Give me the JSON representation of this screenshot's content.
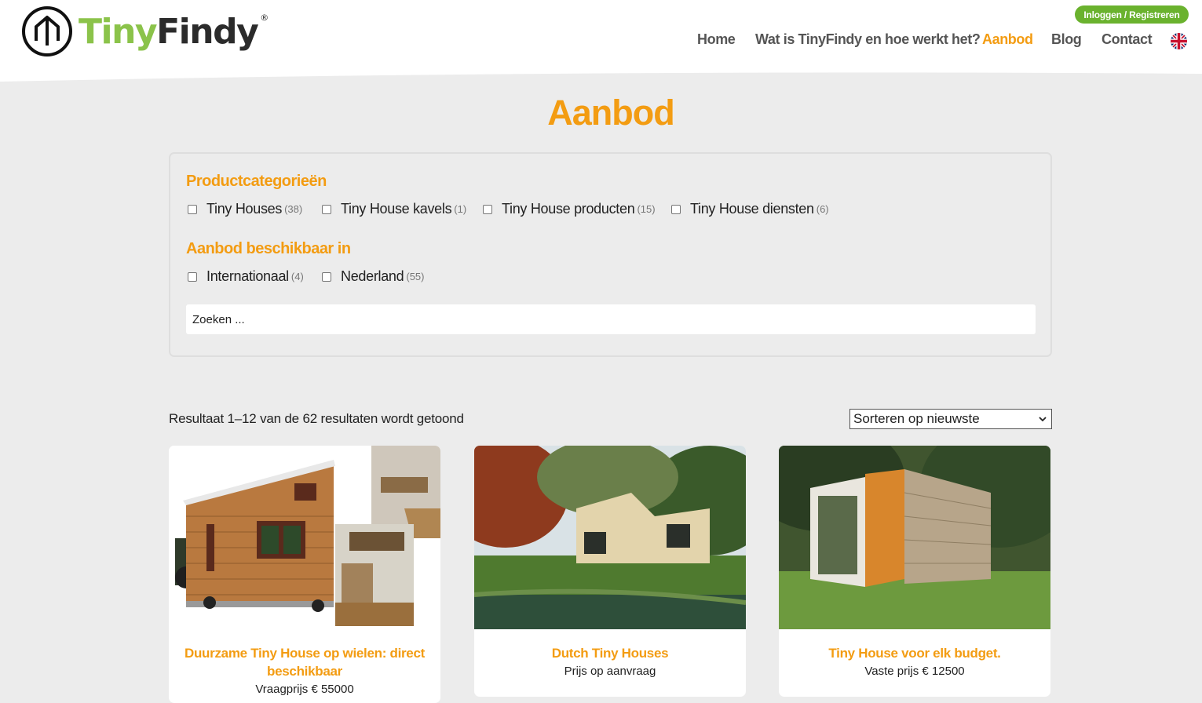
{
  "brand": {
    "name_part1": "Tiny",
    "name_part2": "Findy",
    "registered": "®"
  },
  "header": {
    "login_label": "Inloggen / Registreren",
    "nav": [
      {
        "label": "Home",
        "active": false
      },
      {
        "label": "Wat is TinyFindy en hoe werkt het?",
        "active": false
      },
      {
        "label": "Aanbod",
        "active": true
      },
      {
        "label": "Blog",
        "active": false
      },
      {
        "label": "Contact",
        "active": false
      }
    ],
    "language_icon": "uk-flag-icon"
  },
  "page": {
    "title": "Aanbod"
  },
  "filters": {
    "categories_heading": "Productcategorieën",
    "categories": [
      {
        "label": "Tiny Houses",
        "count": "(38)",
        "checked": false
      },
      {
        "label": "Tiny House kavels",
        "count": "(1)",
        "checked": false
      },
      {
        "label": "Tiny House producten",
        "count": "(15)",
        "checked": false
      },
      {
        "label": "Tiny House diensten",
        "count": "(6)",
        "checked": false
      }
    ],
    "availability_heading": "Aanbod beschikbaar in",
    "availability": [
      {
        "label": "Internationaal",
        "count": "(4)",
        "checked": false
      },
      {
        "label": "Nederland",
        "count": "(55)",
        "checked": false
      }
    ],
    "search_placeholder": "Zoeken ..."
  },
  "results": {
    "count_text": "Resultaat 1–12 van de 62 resultaten wordt getoond",
    "sort_selected": "Sorteren op nieuwste"
  },
  "products": [
    {
      "title": "Duurzame Tiny House op wielen: direct beschikbaar",
      "price": "Vraagprijs € 55000"
    },
    {
      "title": "Dutch Tiny Houses",
      "price": "Prijs op aanvraag"
    },
    {
      "title": "Tiny House voor elk budget.",
      "price": "Vaste prijs € 12500"
    }
  ],
  "colors": {
    "accent": "#f39c12",
    "brand_green": "#8bc34a",
    "login_green": "#6ab22e",
    "background": "#ececec"
  }
}
